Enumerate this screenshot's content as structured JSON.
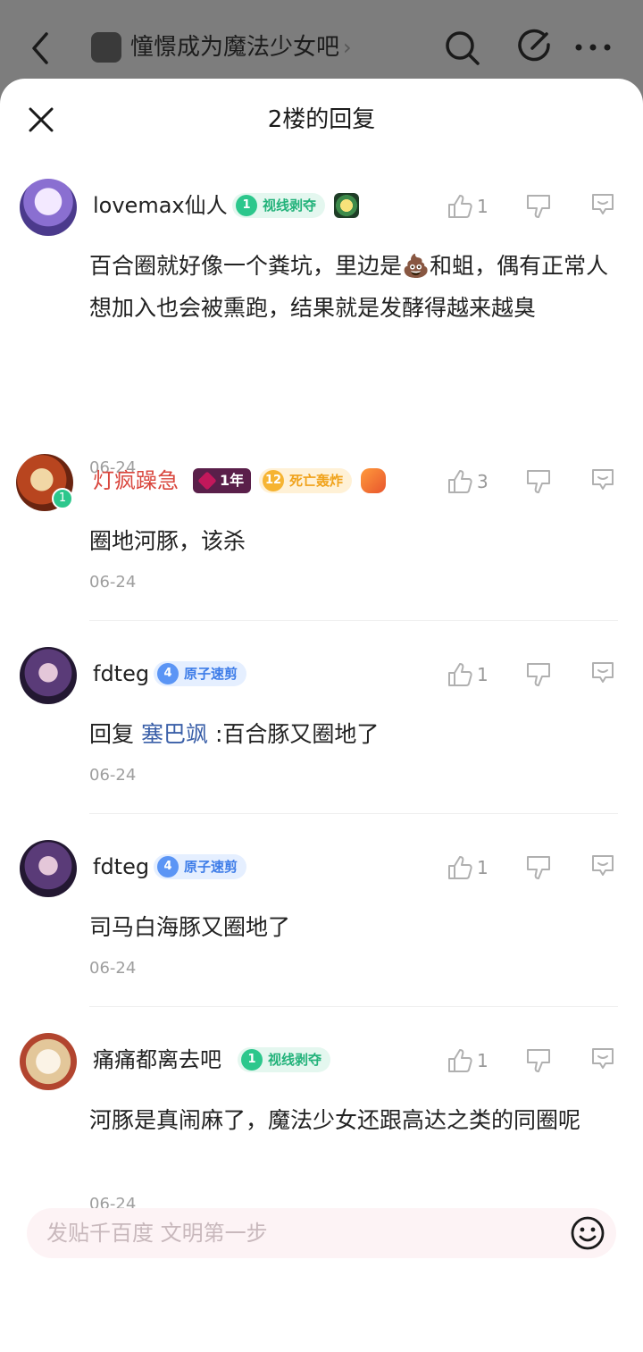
{
  "topbar": {
    "forum_name": "憧憬成为魔法少女吧",
    "chevron": "›",
    "icons": [
      "back-icon",
      "search-icon",
      "edit-icon",
      "more-icon"
    ]
  },
  "sheet": {
    "title": "2楼的回复",
    "close_icon": "close-icon"
  },
  "comments": [
    {
      "username": "lovemax仙人",
      "badge_level": "1",
      "badge_text": "视线剥夺",
      "likes": "1",
      "text_pre": "百合圈就好像一个粪坑，里边是",
      "emoji": "💩",
      "text_post": "和蛆，偶有正常人想加入也会被熏跑，结果就是发酵得越来越臭",
      "date": "06-24"
    },
    {
      "username": "灯疯躁急",
      "avatar_level": "1",
      "year_badge": "1年",
      "badge_level": "12",
      "badge_text": "死亡轰炸",
      "likes": "3",
      "text": "圈地河豚，该杀",
      "date": "06-24"
    },
    {
      "username": "fdteg",
      "badge_level": "4",
      "badge_text": "原子速剪",
      "likes": "1",
      "reply_prefix": "回复",
      "mention": "塞巴飒",
      "text": ":百合豚又圈地了",
      "date": "06-24"
    },
    {
      "username": "fdteg",
      "badge_level": "4",
      "badge_text": "原子速剪",
      "likes": "1",
      "text": "司马白海豚又圈地了",
      "date": "06-24"
    },
    {
      "username": "痛痛都离去吧",
      "badge_level": "1",
      "badge_text": "视线剥夺",
      "likes": "1",
      "text": "河豚是真闹麻了，魔法少女还跟高达之类的同圈呢",
      "date": "06-24"
    }
  ],
  "input": {
    "placeholder": "发贴千百度 文明第一步",
    "emoji_icon": "smiley-icon"
  },
  "colors": {
    "accent_red_name": "#d9463d",
    "mention_blue": "#3a5fa8",
    "badge_green": "#22b27a",
    "badge_blue": "#3d7ce8",
    "badge_orange": "#f0a21a"
  }
}
